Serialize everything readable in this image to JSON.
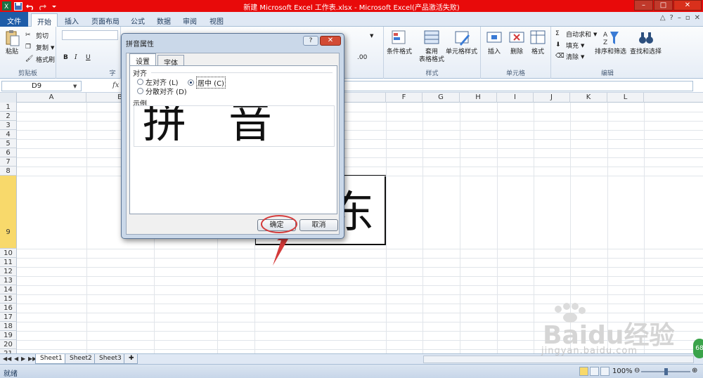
{
  "window": {
    "title": "新建 Microsoft Excel 工作表.xlsx  -  Microsoft Excel(产品激活失败)",
    "controls": [
      "–",
      "□",
      "✕"
    ]
  },
  "tabs": {
    "file": "文件",
    "items": [
      "开始",
      "插入",
      "页面布局",
      "公式",
      "数据",
      "审阅",
      "视图"
    ]
  },
  "ribbon": {
    "clipboard": {
      "paste": "粘贴",
      "cut": "剪切",
      "copy": "复制",
      "format_painter": "格式刷",
      "label": "剪贴板"
    },
    "font": {
      "label": "字"
    },
    "styles": {
      "cond_format": "条件格式",
      "table_format_line1": "套用",
      "table_format_line2": "表格格式",
      "cell_style": "单元格样式",
      "label": "样式"
    },
    "cells": {
      "insert": "插入",
      "delete": "删除",
      "format": "格式",
      "label": "单元格"
    },
    "editing": {
      "autosum": "自动求和",
      "fill": "填充",
      "clear": "清除",
      "sort_filter": "排序和筛选",
      "find_select": "查找和选择",
      "label": "编辑"
    }
  },
  "formula_bar": {
    "name_box": "D9",
    "fx": "fx"
  },
  "grid": {
    "columns": [
      "A",
      "B",
      "C",
      "D",
      "E",
      "F",
      "G",
      "H",
      "I",
      "J",
      "K",
      "L"
    ],
    "rows": [
      "1",
      "2",
      "3",
      "4",
      "5",
      "6",
      "7",
      "8",
      "9",
      "10",
      "11",
      "12",
      "13",
      "14",
      "15",
      "16",
      "17",
      "18",
      "19",
      "20",
      "21"
    ],
    "active_cell": "D9",
    "cell_text": "东"
  },
  "sheets": [
    "Sheet1",
    "Sheet2",
    "Sheet3"
  ],
  "status": {
    "ready": "就绪",
    "zoom": "100%"
  },
  "dialog": {
    "title": "拼音属性",
    "help": "?",
    "close": "✕",
    "tabs": [
      "设置",
      "字体"
    ],
    "align_label": "对齐",
    "options": {
      "left": "左对齐 (L)",
      "center": "居中 (C)",
      "distributed": "分散对齐 (D)"
    },
    "selected": "center",
    "sample_label": "示例",
    "sample_text": "拼音",
    "ok": "确定",
    "cancel": "取消"
  },
  "watermark": {
    "brand": "Baidu经验",
    "url": "jingyan.baidu.com"
  },
  "colors": {
    "title_bar": "#e80a0a",
    "file_tab": "#1e5ca8",
    "highlight": "#f8d96b",
    "annotation": "#d43a3a"
  }
}
